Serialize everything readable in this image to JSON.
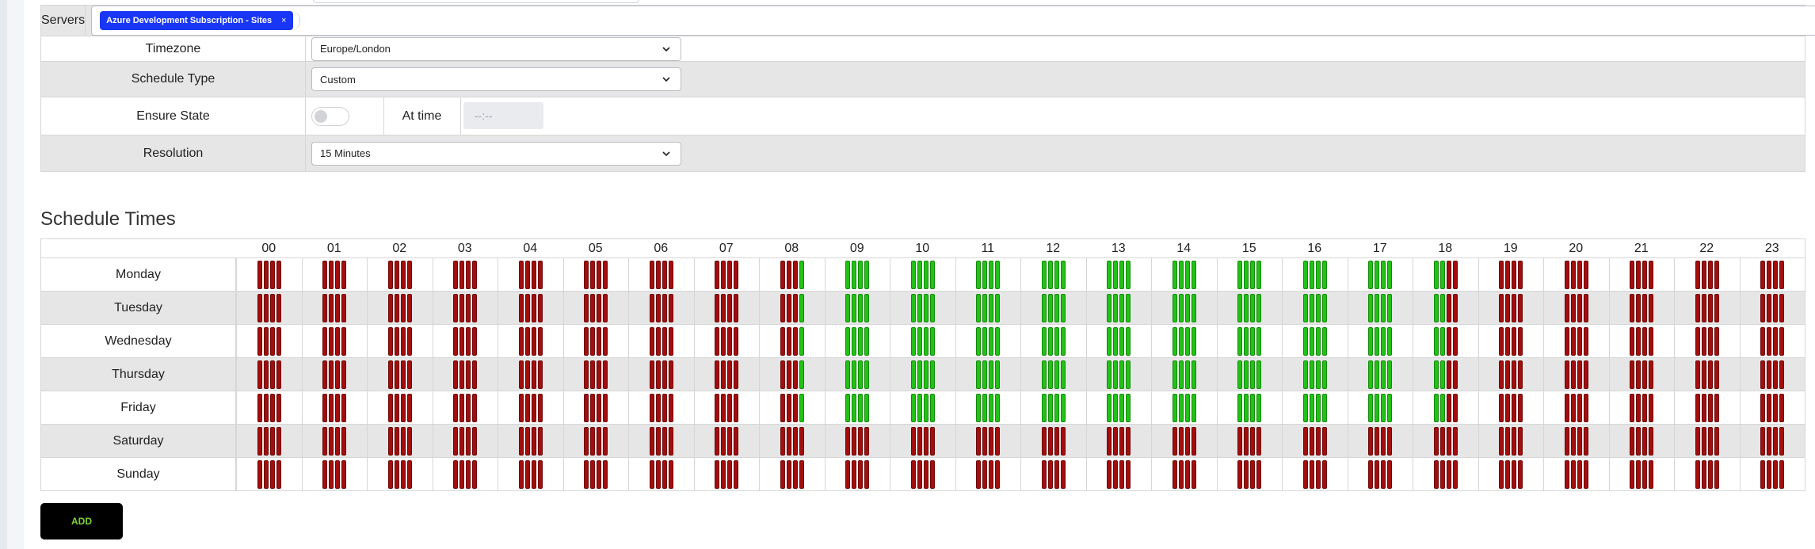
{
  "form": {
    "servers": {
      "label": "Servers",
      "tag": "Azure Development Subscription - Sites",
      "tag_remove": "×"
    },
    "timezone": {
      "label": "Timezone",
      "value": "Europe/London"
    },
    "schedule_type": {
      "label": "Schedule Type",
      "value": "Custom"
    },
    "ensure_state": {
      "label": "Ensure State",
      "enabled": false,
      "at_time_label": "At time",
      "time_placeholder": "--:--"
    },
    "resolution": {
      "label": "Resolution",
      "value": "15 Minutes"
    }
  },
  "schedule": {
    "title": "Schedule Times",
    "hours": [
      "00",
      "01",
      "02",
      "03",
      "04",
      "05",
      "06",
      "07",
      "08",
      "09",
      "10",
      "11",
      "12",
      "13",
      "14",
      "15",
      "16",
      "17",
      "18",
      "19",
      "20",
      "21",
      "22",
      "23"
    ],
    "slots_per_hour": 4,
    "colors": {
      "on": "#22c215",
      "off": "#a30d0d"
    },
    "days": [
      {
        "name": "Monday",
        "on_slots": [
          [
            8,
            3
          ],
          [
            18,
            2
          ]
        ]
      },
      {
        "name": "Tuesday",
        "on_slots": [
          [
            8,
            3
          ],
          [
            18,
            2
          ]
        ]
      },
      {
        "name": "Wednesday",
        "on_slots": [
          [
            8,
            3
          ],
          [
            18,
            2
          ]
        ]
      },
      {
        "name": "Thursday",
        "on_slots": [
          [
            8,
            3
          ],
          [
            18,
            2
          ]
        ]
      },
      {
        "name": "Friday",
        "on_slots": [
          [
            8,
            3
          ],
          [
            18,
            2
          ]
        ]
      },
      {
        "name": "Saturday",
        "on_slots": null
      },
      {
        "name": "Sunday",
        "on_slots": null
      }
    ]
  },
  "actions": {
    "add_label": "ADD"
  }
}
